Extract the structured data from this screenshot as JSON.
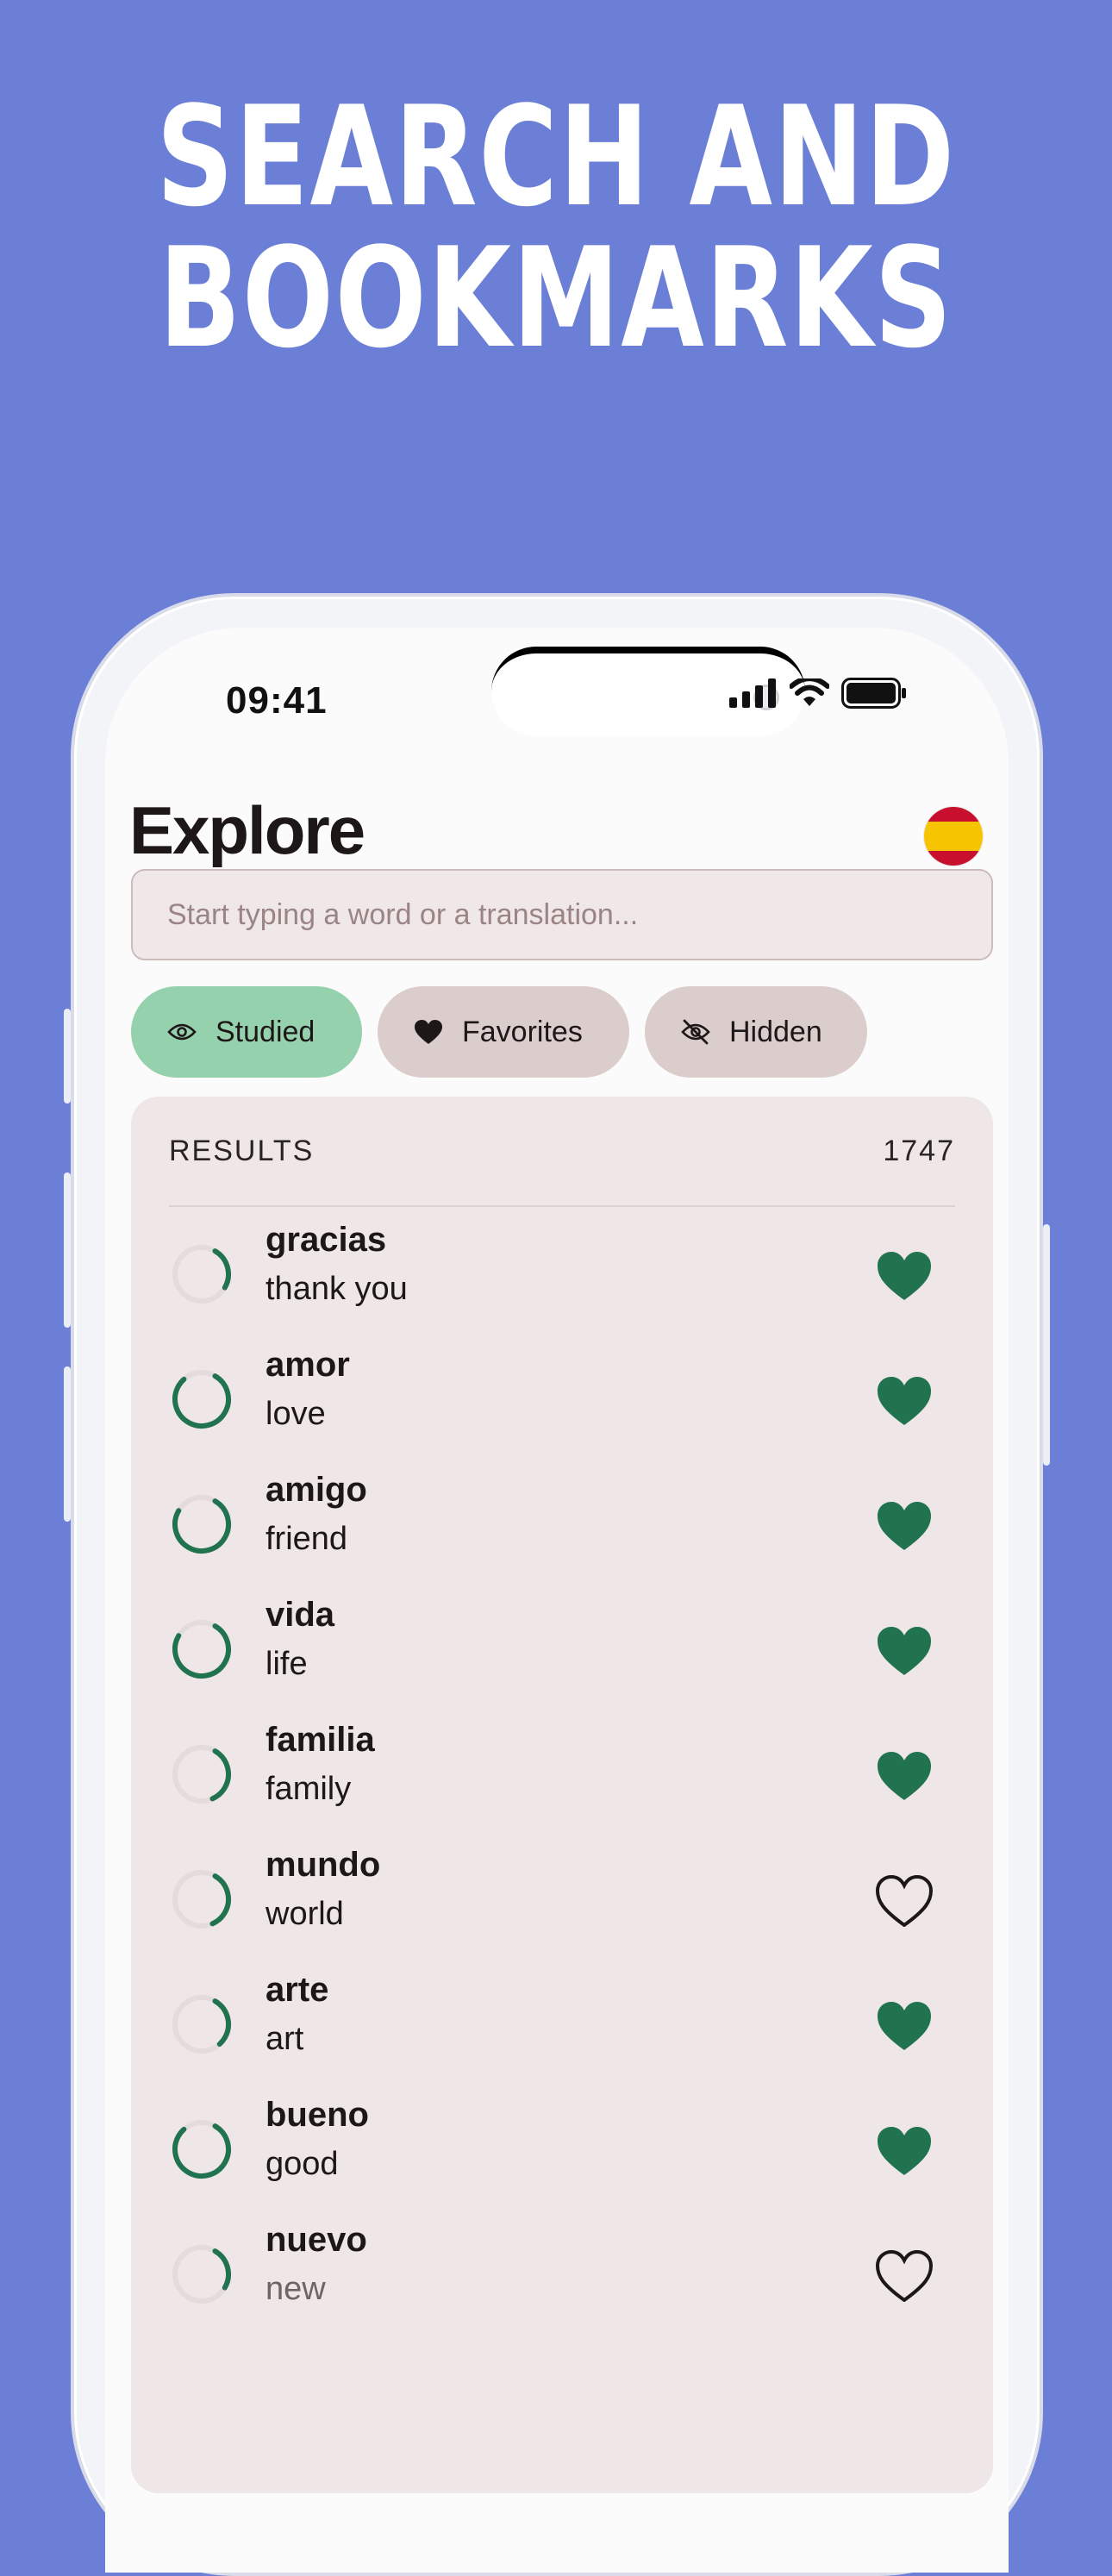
{
  "headline": {
    "line1": "SEARCH AND",
    "line2": "BOOKMARKS"
  },
  "status_bar": {
    "time": "09:41"
  },
  "header": {
    "title": "Explore",
    "language_flag": "spain-flag-icon"
  },
  "search": {
    "placeholder": "Start typing a word or a translation..."
  },
  "filters": [
    {
      "label": "Studied",
      "icon": "eye-icon",
      "active": true
    },
    {
      "label": "Favorites",
      "icon": "heart-icon",
      "active": false
    },
    {
      "label": "Hidden",
      "icon": "eye-off-icon",
      "active": false
    }
  ],
  "results": {
    "label": "RESULTS",
    "count": "1747",
    "items": [
      {
        "word": "gracias",
        "translation": "thank you",
        "progress": 0.25,
        "favorite": true
      },
      {
        "word": "amor",
        "translation": "love",
        "progress": 0.8,
        "favorite": true
      },
      {
        "word": "amigo",
        "translation": "friend",
        "progress": 0.75,
        "favorite": true
      },
      {
        "word": "vida",
        "translation": "life",
        "progress": 0.75,
        "favorite": true
      },
      {
        "word": "familia",
        "translation": "family",
        "progress": 0.35,
        "favorite": true
      },
      {
        "word": "mundo",
        "translation": "world",
        "progress": 0.35,
        "favorite": false
      },
      {
        "word": "arte",
        "translation": "art",
        "progress": 0.3,
        "favorite": true
      },
      {
        "word": "bueno",
        "translation": "good",
        "progress": 0.8,
        "favorite": true
      },
      {
        "word": "nuevo",
        "translation": "new",
        "progress": 0.25,
        "favorite": false
      }
    ]
  },
  "colors": {
    "background": "#6b7fd7",
    "accent_green": "#217350",
    "chip_active": "#96d1ae",
    "chip_inactive": "#dccdcd",
    "panel": "#efe7e7"
  }
}
